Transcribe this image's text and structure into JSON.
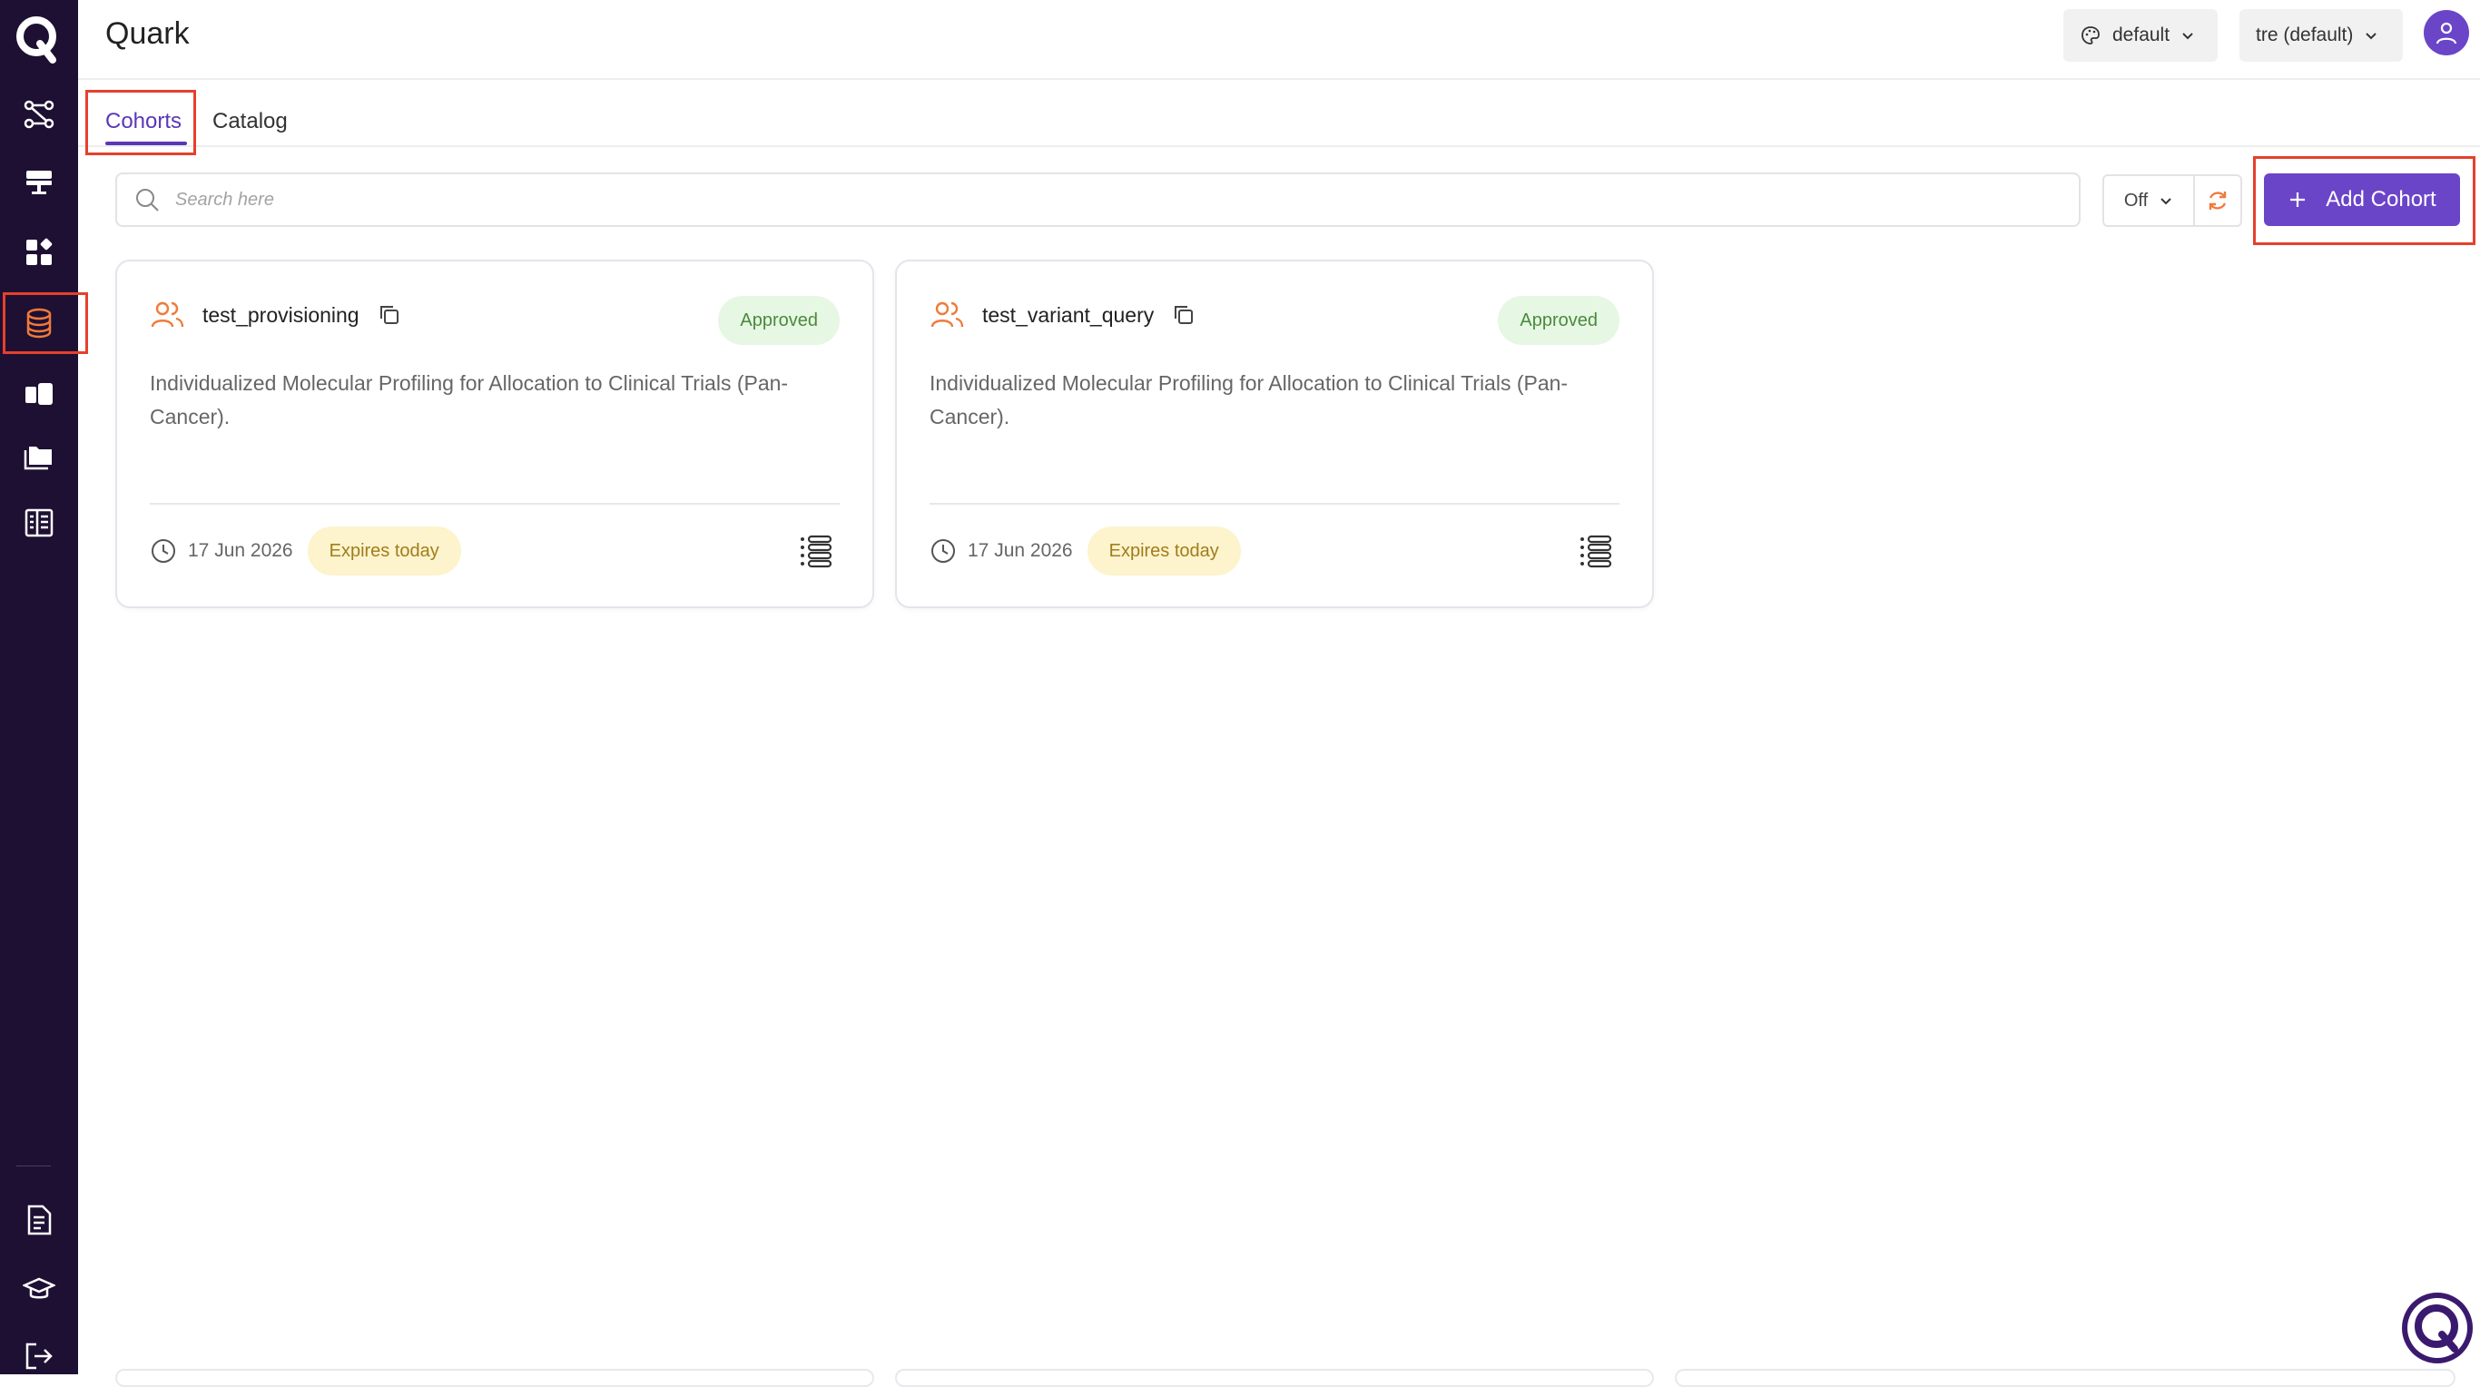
{
  "app": {
    "title": "Quark",
    "logo_letter": "Q"
  },
  "header": {
    "theme_label": "default",
    "workspace_label": "tre (default)"
  },
  "sidebar": {
    "items": [
      {
        "name": "workflow-icon"
      },
      {
        "name": "server-icon"
      },
      {
        "name": "apps-icon"
      },
      {
        "name": "database-icon",
        "active": true
      },
      {
        "name": "cards-icon"
      },
      {
        "name": "folder-icon"
      },
      {
        "name": "table-icon"
      }
    ],
    "bottom_items": [
      {
        "name": "document-icon"
      },
      {
        "name": "graduation-cap-icon"
      },
      {
        "name": "logout-icon"
      }
    ]
  },
  "tabs": [
    {
      "label": "Cohorts",
      "active": true
    },
    {
      "label": "Catalog",
      "active": false
    }
  ],
  "search": {
    "placeholder": "Search here"
  },
  "refresh": {
    "interval_label": "Off"
  },
  "add_button": {
    "label": "Add Cohort"
  },
  "cohorts": [
    {
      "name": "test_provisioning",
      "status": "Approved",
      "description": "Individualized Molecular Profiling for Allocation to Clinical Trials (Pan-Cancer).",
      "date": "17 Jun 2026",
      "expiry": "Expires today"
    },
    {
      "name": "test_variant_query",
      "status": "Approved",
      "description": "Individualized Molecular Profiling for Allocation to Clinical Trials (Pan-Cancer).",
      "date": "17 Jun 2026",
      "expiry": "Expires today"
    }
  ],
  "colors": {
    "sidebar_bg": "#1e1033",
    "accent": "#6b45c8",
    "highlight": "#e5402c",
    "orange_icon": "#f07a3a",
    "approved_bg": "#e6f7e3",
    "expiry_bg": "#fdf3cc"
  }
}
